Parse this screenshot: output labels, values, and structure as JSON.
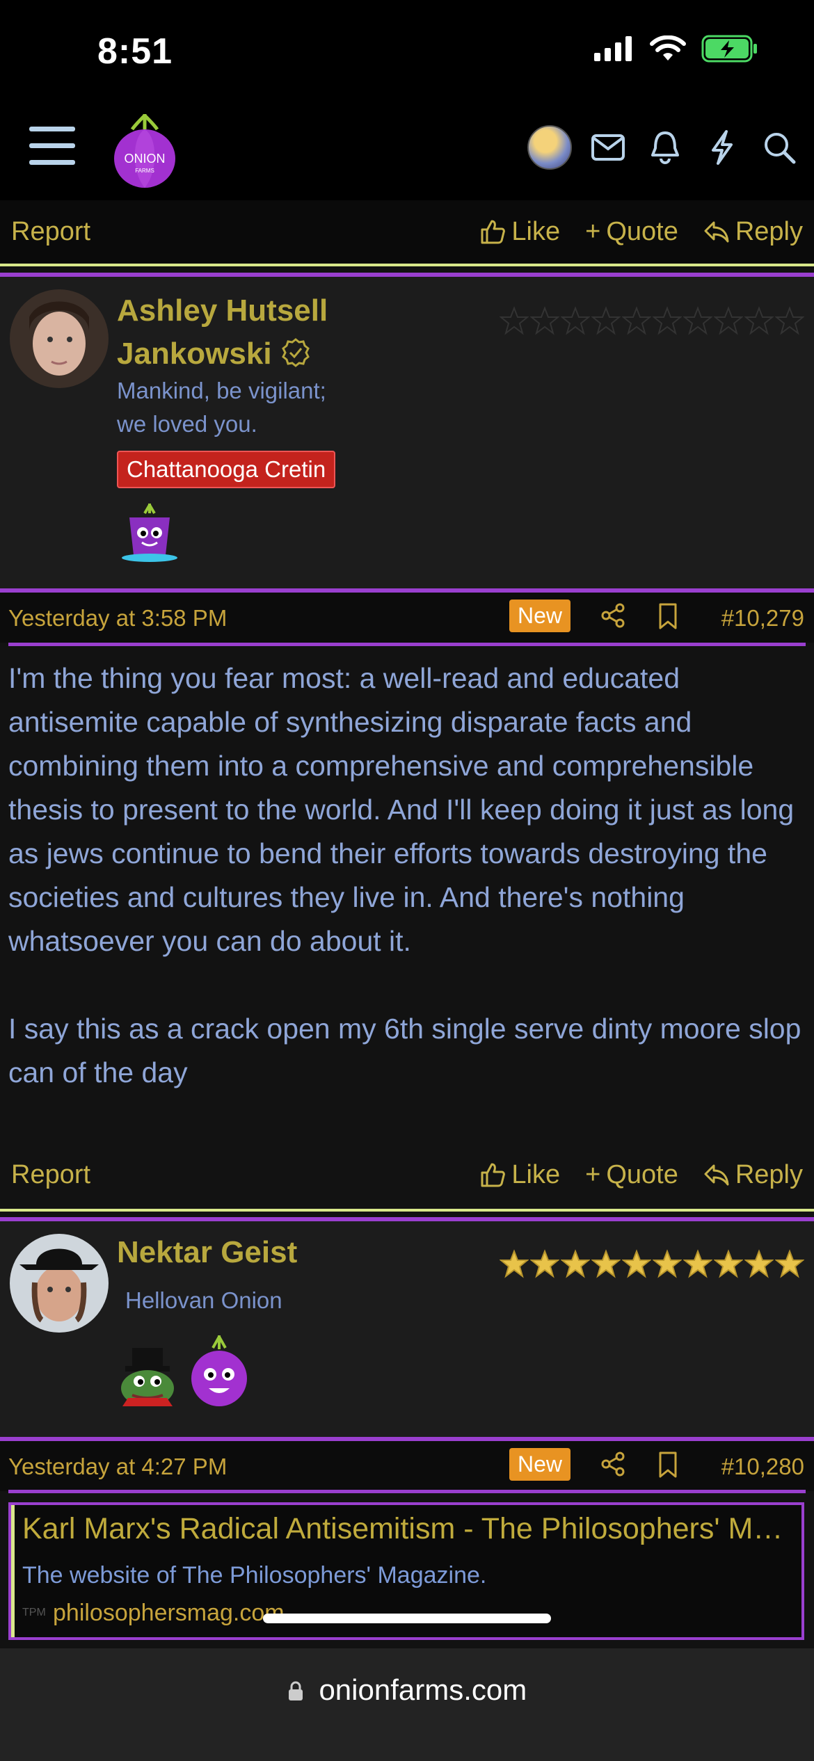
{
  "status": {
    "time": "8:51"
  },
  "nav": {
    "logo_text": "ONION",
    "logo_sub": "FARMS"
  },
  "top_action_bar": {
    "report": "Report",
    "like": "Like",
    "quote": "Quote",
    "reply": "Reply"
  },
  "posts": [
    {
      "author_line1": "Ashley Hutsell",
      "author_line2": "Jankowski",
      "subtitle_line1": "Mankind, be vigilant;",
      "subtitle_line2": "we loved you.",
      "badge": "Chattanooga Cretin",
      "stars_filled": 0,
      "date": "Yesterday at 3:58 PM",
      "new_label": "New",
      "post_number": "#10,279",
      "body_p1": "I'm the thing you fear most: a well-read and educated antisemite capable of synthesizing disparate facts and combining them into a comprehensive and comprehensible thesis to present to the world. And I'll keep doing it just as long as jews continue to bend their efforts towards destroying the societies and cultures they live in. And there's nothing whatsoever you can do about it.",
      "body_p2": "I say this as a crack open my 6th single serve dinty moore slop can of the day",
      "report": "Report",
      "like": "Like",
      "quote": "Quote",
      "reply": "Reply"
    },
    {
      "author_line1": "Nektar Geist",
      "subtitle_line1": "Hellovan Onion",
      "stars_filled": 10,
      "date": "Yesterday at 4:27 PM",
      "new_label": "New",
      "post_number": "#10,280",
      "link_title": "Karl Marx's Radical Antisemitism - The Philosophers' Magazine",
      "link_desc": "The website of The Philosophers' Magazine.",
      "link_fav": "TPM",
      "link_domain": "philosophersmag.com"
    }
  ],
  "browser": {
    "url": "onionfarms.com"
  },
  "colors": {
    "accent_purple": "#9a3fcf",
    "gold": "#c7b24a",
    "blue_text": "#8fa6d8",
    "new_badge": "#e89322"
  }
}
